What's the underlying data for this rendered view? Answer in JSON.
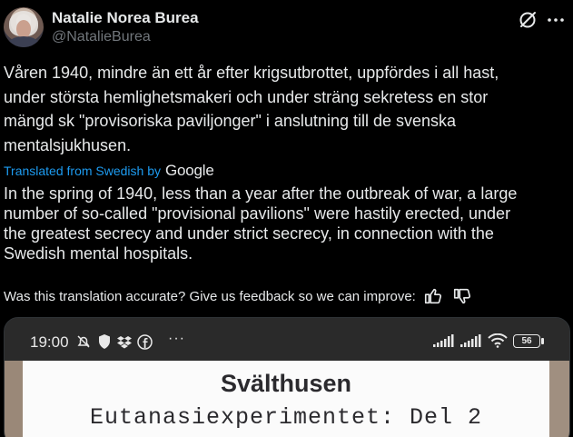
{
  "author": {
    "display_name": "Natalie Norea Burea",
    "handle": "@NatalieBurea"
  },
  "header_icons": {
    "grok": "grok-icon",
    "more": "more-icon"
  },
  "tweet": {
    "original_text": "Våren 1940, mindre än ett år efter krigsutbrottet, uppfördes i all hast,\nunder största hemlighetsmakeri och under sträng sekretess en stor\nmängd sk \"provisoriska paviljonger\" i anslutning till de svenska\nmentalsjukhusen.",
    "translated_from_label": "Translated from Swedish by",
    "translator_brand": "Google",
    "translated_text": "In the spring of 1940, less than a year after the outbreak of war, a large\nnumber of so-called \"provisional pavilions\" were hastily erected, under\nthe greatest secrecy and under strict secrecy, in connection with the\nSwedish mental hospitals.",
    "feedback_prompt": "Was this translation accurate? Give us feedback so we can improve:"
  },
  "media": {
    "status_bar": {
      "time": "19:00",
      "dots": "···",
      "battery": "56"
    },
    "document": {
      "title": "Svälthusen",
      "subtitle": "Eutanasiexperimentet: Del 2"
    }
  },
  "colors": {
    "background": "#000000",
    "text": "#e7e9ea",
    "muted": "#71767b",
    "link": "#1d9bf0"
  }
}
